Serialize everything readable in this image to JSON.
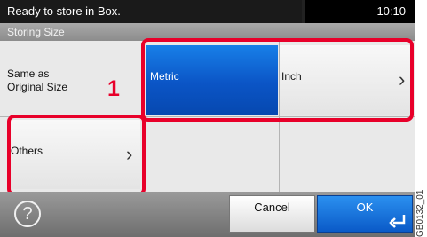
{
  "status": {
    "message": "Ready to store in Box.",
    "time": "10:10"
  },
  "screen_title": "Storing Size",
  "row_label": "Same as Original Size",
  "options": {
    "metric": "Metric",
    "inch": "Inch",
    "others": "Others"
  },
  "callout": "1",
  "footer": {
    "help": "?",
    "cancel": "Cancel",
    "ok": "OK"
  },
  "figure_code": "GB0132_01",
  "colors": {
    "selected": "#0b55c6",
    "highlight": "#e8002a"
  }
}
